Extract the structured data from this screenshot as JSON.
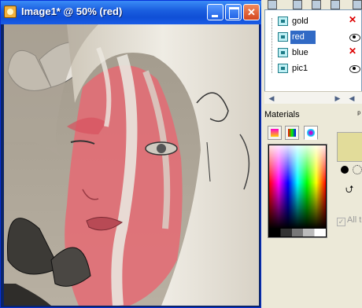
{
  "window": {
    "title": "Image1* @  50% (red)"
  },
  "layers": {
    "items": [
      {
        "label": "gold",
        "selected": false
      },
      {
        "label": "red",
        "selected": true
      },
      {
        "label": "blue",
        "selected": false
      },
      {
        "label": "pic1",
        "selected": false
      }
    ]
  },
  "materials": {
    "title": "Materials",
    "foreground_color": "#e2dc9a",
    "all_tools_label": "All to"
  },
  "colors": {
    "title_blue": "#1b5fe0",
    "selection": "#316ac5",
    "overlay_red": "#e8606a"
  }
}
